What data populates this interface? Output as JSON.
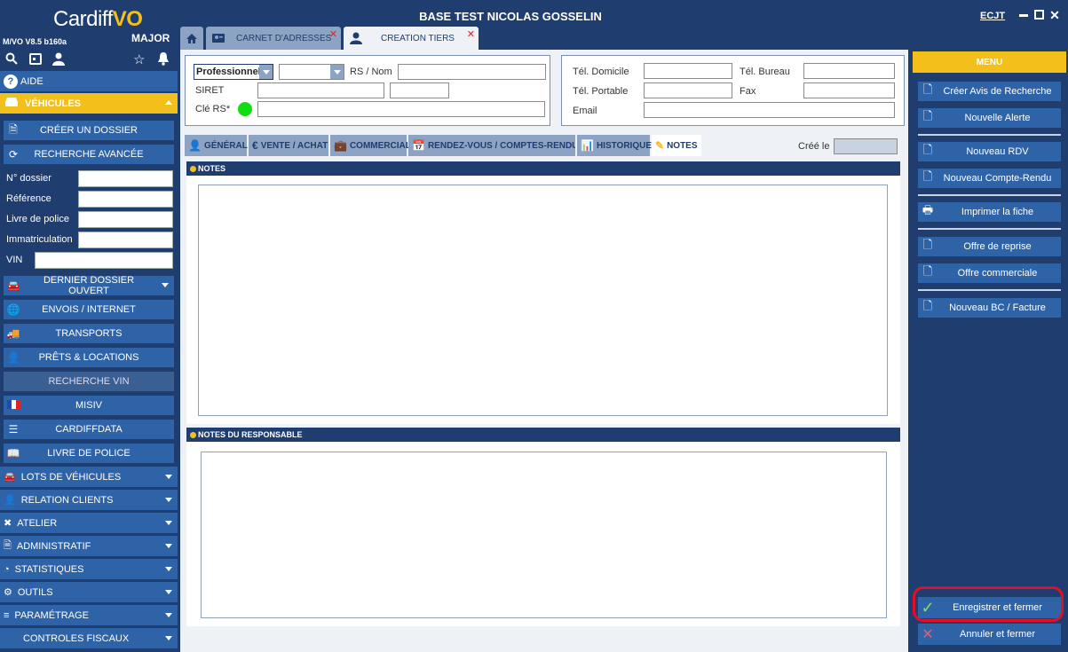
{
  "app": {
    "logo_main": "Cardiff",
    "logo_accent": "VO",
    "logo_sub": "MAJOR",
    "version": "M/VO V8.5 b160a",
    "title": "BASE TEST NICOLAS GOSSELIN",
    "user": "ECJT"
  },
  "tabs": [
    {
      "label": "CARNET D'ADRESSES"
    },
    {
      "label": "CREATION TIERS"
    }
  ],
  "sidebar": {
    "aide": "AIDE",
    "vehicules": "VÉHICULES",
    "creer_dossier": "CRÉER UN DOSSIER",
    "recherche_avancee": "RECHERCHE AVANCÉE",
    "fields": {
      "n_dossier": "N° dossier",
      "reference": "Référence",
      "livre_police": "Livre de police",
      "immatriculation": "Immatriculation",
      "vin": "VIN"
    },
    "buttons": [
      "DERNIER DOSSIER OUVERT",
      "ENVOIS / INTERNET",
      "TRANSPORTS",
      "PRÊTS & LOCATIONS",
      "RECHERCHE VIN",
      "MISIV",
      "CARDIFFDATA",
      "LIVRE DE POLICE"
    ],
    "sections": [
      "LOTS DE VÉHICULES",
      "RELATION CLIENTS",
      "ATELIER",
      "ADMINISTRATIF",
      "STATISTIQUES",
      "OUTILS",
      "PARAMÉTRAGE",
      "CONTROLES FISCAUX"
    ]
  },
  "form": {
    "type_value": "Professionnel",
    "rs_nom_label": "RS / Nom",
    "siret_label": "SIRET",
    "cle_rs_label": "Clé RS*",
    "tel_domicile": "Tél. Domicile",
    "tel_bureau": "Tél. Bureau",
    "tel_portable": "Tél. Portable",
    "fax": "Fax",
    "email": "Email",
    "cree_le": "Créé le"
  },
  "subtabs": [
    "GÉNÉRAL",
    "VENTE / ACHAT",
    "COMMERCIAL",
    "RENDEZ-VOUS / COMPTES-RENDUS",
    "HISTORIQUE",
    "NOTES"
  ],
  "sections": {
    "notes": "NOTES",
    "notes_responsable": "NOTES DU RESPONSABLE"
  },
  "menu": {
    "title": "MENU",
    "items": [
      "Créer Avis de Recherche",
      "Nouvelle Alerte",
      "Nouveau RDV",
      "Nouveau Compte-Rendu",
      "Imprimer la fiche",
      "Offre de reprise",
      "Offre commerciale",
      "Nouveau BC / Facture"
    ],
    "save": "Enregistrer et fermer",
    "cancel": "Annuler et fermer"
  },
  "colors": {
    "navy": "#1f3d6e",
    "blue": "#2f63a8",
    "yellow": "#f3c01b",
    "highlight": "#e0102a"
  }
}
